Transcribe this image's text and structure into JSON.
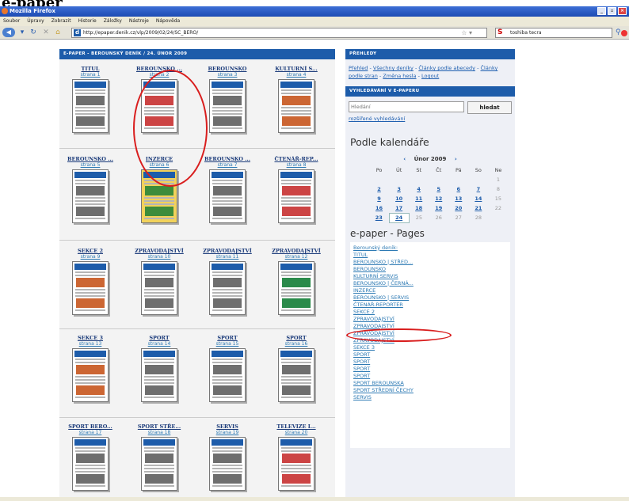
{
  "heading": "e-paper",
  "window": {
    "title": "Mozilla Firefox"
  },
  "menu": [
    "Soubor",
    "Úpravy",
    "Zobrazit",
    "Historie",
    "Záložky",
    "Nástroje",
    "Nápověda"
  ],
  "nav": {
    "url": "http://epaper.denik.cz/vlp/2009/02/24/SC_BERO/",
    "search_query": "toshiba tecra"
  },
  "left_panel": {
    "header": "E-PAPER - BEROUNSKÝ DENÍK / 24. ÚNOR 2009",
    "pages": [
      {
        "name": "TITUL",
        "num": "strana 1"
      },
      {
        "name": "BEROUNSKO ...",
        "num": "strana 2"
      },
      {
        "name": "BEROUNSKO",
        "num": "strana 3"
      },
      {
        "name": "KULTURNÍ S...",
        "num": "strana 4"
      },
      {
        "name": "BEROUNSKO ...",
        "num": "strana 5"
      },
      {
        "name": "INZERCE",
        "num": "strana 6"
      },
      {
        "name": "BEROUNSKO ...",
        "num": "strana 7"
      },
      {
        "name": "ČTENÁŘ-REP...",
        "num": "strana 8"
      },
      {
        "name": "SEKCE 2",
        "num": "strana 9"
      },
      {
        "name": "ZPRAVODAJSTVÍ",
        "num": "strana 10"
      },
      {
        "name": "ZPRAVODAJSTVÍ",
        "num": "strana 11"
      },
      {
        "name": "ZPRAVODAJSTVÍ",
        "num": "strana 12"
      },
      {
        "name": "SEKCE 3",
        "num": "strana 13"
      },
      {
        "name": "SPORT",
        "num": "strana 14"
      },
      {
        "name": "SPORT",
        "num": "strana 15"
      },
      {
        "name": "SPORT",
        "num": "strana 16"
      },
      {
        "name": "SPORT BERO...",
        "num": "strana 17"
      },
      {
        "name": "SPORT STŘE...",
        "num": "strana 18"
      },
      {
        "name": "SERVIS",
        "num": "strana 19"
      },
      {
        "name": "TELEVIZE I...",
        "num": "strana 20"
      }
    ]
  },
  "overview": {
    "header": "PŘEHLEDY",
    "links": [
      "Přehled",
      "Všechny deníky",
      "Články podle abecedy",
      "Články podle stran",
      "Změna hesla",
      "Logout"
    ],
    "sep": " - "
  },
  "search": {
    "header": "VYHLEDÁVÁNÍ V E-PAPERU",
    "placeholder": "Hledání",
    "button": "hledat",
    "advanced": "rozšířené vyhledávání"
  },
  "calendar": {
    "title": "Podle kalendáře",
    "prev": "‹",
    "next": "›",
    "month": "Únor 2009",
    "weekdays": [
      "Po",
      "Út",
      "St",
      "Čt",
      "Pá",
      "So",
      "Ne"
    ],
    "weeks": [
      [
        "",
        "",
        "",
        "",
        "",
        "",
        "1"
      ],
      [
        "2",
        "3",
        "4",
        "5",
        "6",
        "7",
        "8"
      ],
      [
        "9",
        "10",
        "11",
        "12",
        "13",
        "14",
        "15"
      ],
      [
        "16",
        "17",
        "18",
        "19",
        "20",
        "21",
        "22"
      ],
      [
        "23",
        "24",
        "25",
        "26",
        "27",
        "28",
        ""
      ]
    ],
    "linked_days": [
      "2",
      "3",
      "4",
      "5",
      "6",
      "7",
      "9",
      "10",
      "11",
      "12",
      "13",
      "14",
      "16",
      "17",
      "18",
      "19",
      "20",
      "21",
      "23",
      "24"
    ],
    "today": "24"
  },
  "pages_box": {
    "title": "e-paper - Pages",
    "items": [
      "Berounský deník:",
      "TITUL",
      "BEROUNSKO | STŘED...",
      "BEROUNSKO",
      "KULTURNÍ SERVIS",
      "BEROUNSKO | ČERNÁ...",
      "INZERCE",
      "BEROUNSKO | SERVIS",
      "ČTENÁŘ-REPORTÉR",
      "SEKCE 2",
      "ZPRAVODAJSTVÍ",
      "ZPRAVODAJSTVÍ",
      "ZPRAVODAJSTVÍ",
      "ZPRAVODAJSTVÍ",
      "SEKCE 3",
      "SPORT",
      "SPORT",
      "SPORT",
      "SPORT",
      "SPORT BEROUNSKA",
      "SPORT STŘEDNÍ ČECHY",
      "SERVIS"
    ]
  },
  "colors": {
    "accent": "#1d5caa",
    "highlight": "#d91e1e"
  }
}
